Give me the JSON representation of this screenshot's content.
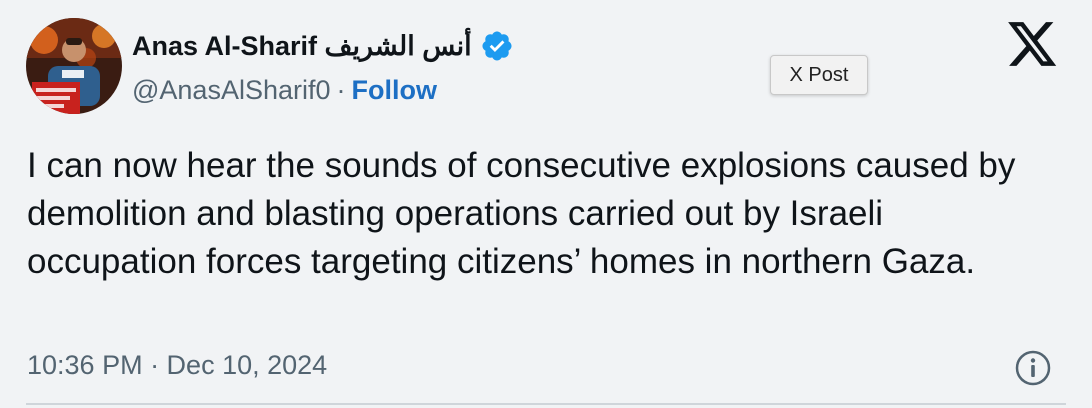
{
  "tweet": {
    "display_name": "Anas Al-Sharif أنس الشريف",
    "handle": "@AnasAlSharif0",
    "separator": "·",
    "follow_label": "Follow",
    "tooltip": "X Post",
    "text": "I can now hear the sounds of consecutive explosions caused by demolition and blasting operations carried out by Israeli occupation forces targeting citizens’ homes in northern Gaza.",
    "timestamp": "10:36 PM · Dec 10, 2024"
  },
  "icons": {
    "verified": "verified-badge-icon",
    "platform": "x-logo-icon",
    "info": "info-icon"
  },
  "colors": {
    "follow": "#1d6fc4",
    "verified": "#1d9bf0",
    "secondary_text": "#536471",
    "primary_text": "#0f1419"
  }
}
